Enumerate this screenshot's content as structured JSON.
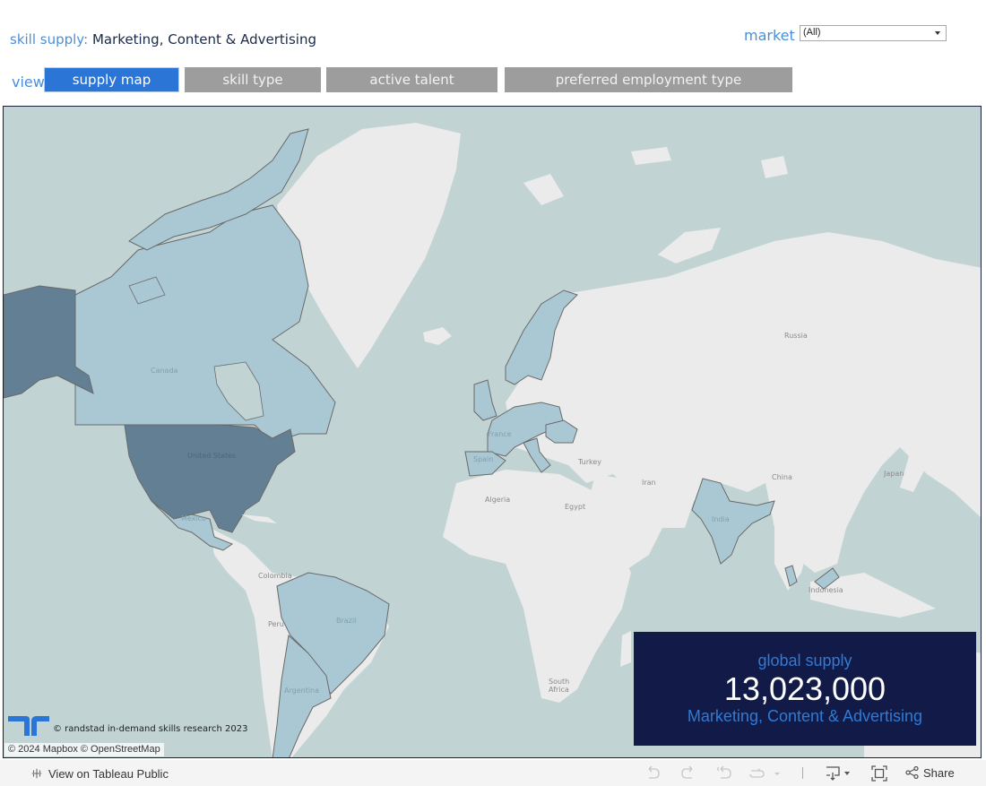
{
  "header": {
    "title_label": "skill supply:",
    "title_value": "Marketing, Content & Advertising",
    "market_label": "market",
    "market_selected": "(All)"
  },
  "view": {
    "label": "view",
    "tabs": [
      {
        "label": "supply map",
        "active": true
      },
      {
        "label": "skill type",
        "active": false
      },
      {
        "label": "active talent",
        "active": false
      },
      {
        "label": "preferred employment type",
        "active": false
      }
    ]
  },
  "map": {
    "highlighted_countries": {
      "dark": [
        "United States (incl. Alaska)"
      ],
      "light": [
        "Canada",
        "Mexico",
        "Brazil",
        "Argentina",
        "United Kingdom",
        "France",
        "Spain",
        "Portugal",
        "Germany",
        "Italy",
        "Norway",
        "Sweden",
        "Poland",
        "Czech Republic",
        "Austria",
        "Switzerland",
        "Belgium",
        "Netherlands",
        "Hungary",
        "Romania",
        "India",
        "Malaysia",
        "Singapore"
      ]
    },
    "labels": [
      "Canada",
      "United States",
      "Mexico",
      "Colombia",
      "Peru",
      "Brazil",
      "Argentina",
      "France",
      "Spain",
      "Turkey",
      "Algeria",
      "Egypt",
      "Iran",
      "Russia",
      "China",
      "Japan",
      "India",
      "Indonesia",
      "South Africa"
    ],
    "copyright": "© randstad in-demand skills research 2023",
    "attribution": "© 2024 Mapbox  © OpenStreetMap",
    "colors": {
      "ocean": "#c1d3d3",
      "land": "#ebebeb",
      "supply_high": "#637f94",
      "supply_low": "#aac8d3"
    }
  },
  "kpi": {
    "label": "global supply",
    "value": "13,023,000",
    "skill": "Marketing, Content & Advertising"
  },
  "footer": {
    "tableau_link": "View on Tableau Public",
    "share_label": "Share",
    "icons": [
      "undo-icon",
      "redo-icon",
      "revert-icon",
      "refresh-icon",
      "download-icon",
      "fullscreen-icon",
      "share-icon"
    ]
  }
}
